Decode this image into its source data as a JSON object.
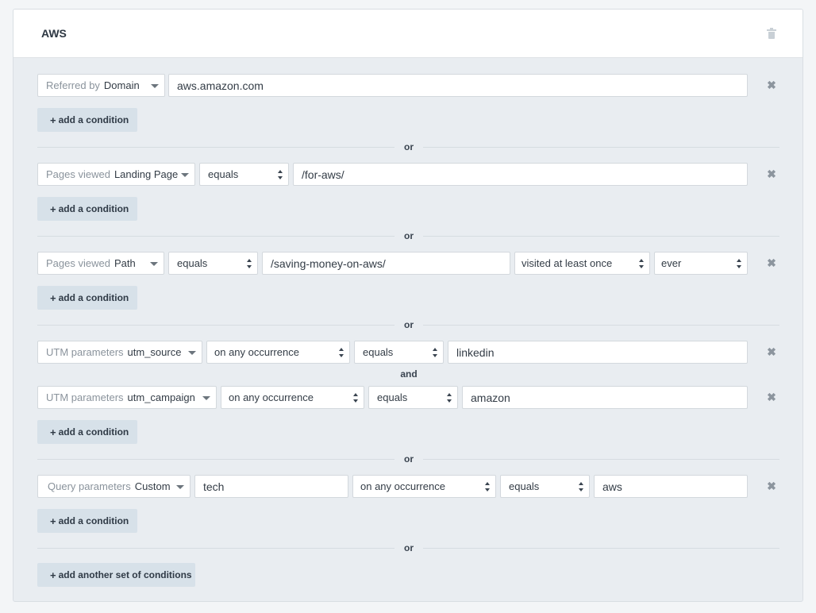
{
  "segment": {
    "title": "AWS",
    "delete_icon": "trash-icon"
  },
  "rows": [
    {
      "type_category": "Referred by",
      "type_sub": "Domain",
      "value": "aws.amazon.com"
    },
    {
      "type_category": "Pages viewed",
      "type_sub": "Landing Page",
      "operator": "equals",
      "value": "/for-aws/"
    },
    {
      "type_category": "Pages viewed",
      "type_sub": "Path",
      "operator": "equals",
      "value": "/saving-money-on-aws/",
      "frequency": "visited at least once",
      "timeframe": "ever"
    },
    {
      "type_category": "UTM parameters",
      "type_sub": "utm_source",
      "occurrence": "on any occurrence",
      "operator": "equals",
      "value": "linkedin"
    },
    {
      "type_category": "UTM parameters",
      "type_sub": "utm_campaign",
      "occurrence": "on any occurrence",
      "operator": "equals",
      "value": "amazon"
    },
    {
      "type_category": "Query parameters",
      "type_sub": "Custom",
      "param_name": "tech",
      "occurrence": "on any occurrence",
      "operator": "equals",
      "value": "aws"
    }
  ],
  "labels": {
    "add_condition": "add a condition",
    "add_set": "add another set of conditions",
    "or": "or",
    "and": "and",
    "plus": "+",
    "remove": "✖"
  }
}
